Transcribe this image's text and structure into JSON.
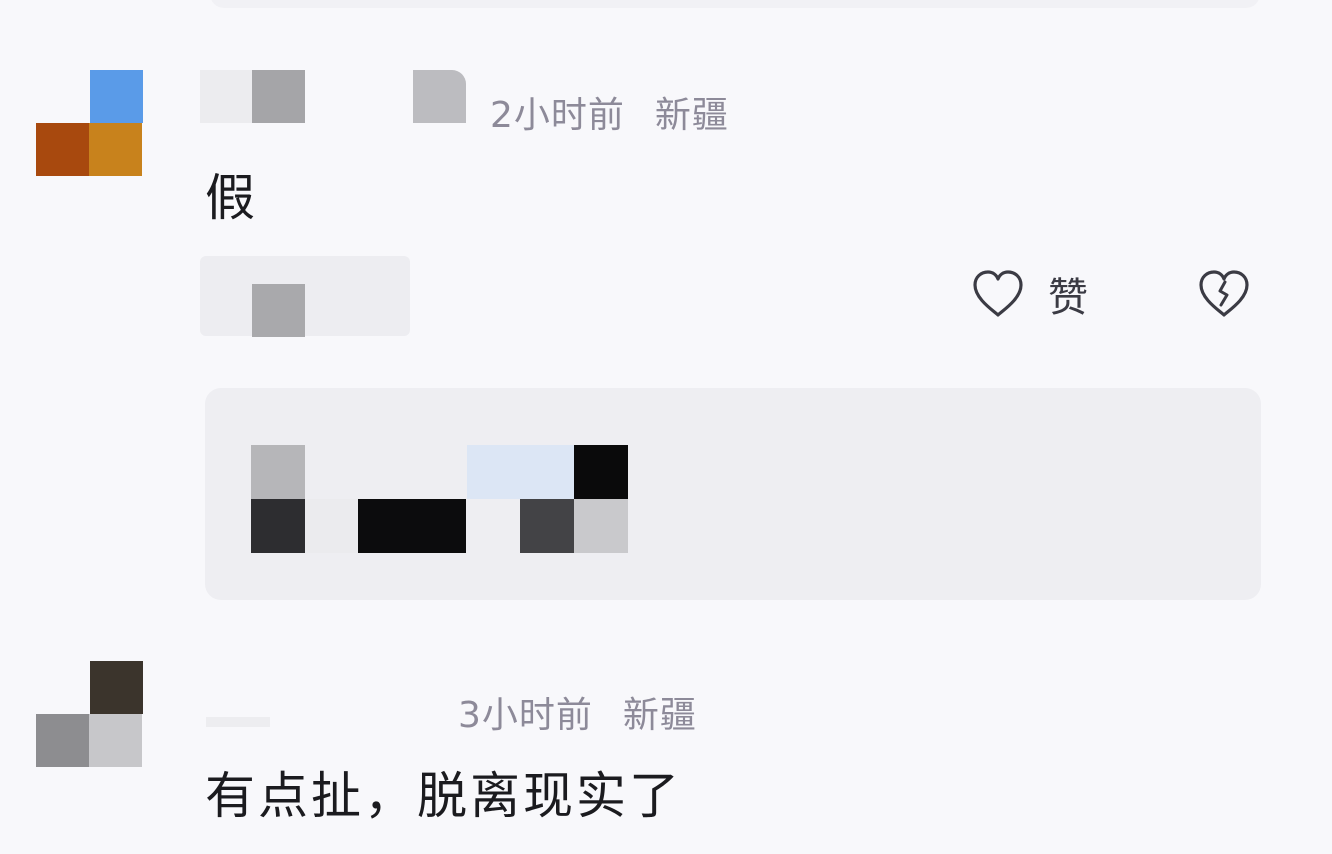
{
  "comments": [
    {
      "time": "2小时前",
      "location": "新疆",
      "text": "假",
      "actions": {
        "like_label": "赞"
      }
    },
    {
      "time": "3小时前",
      "location": "新疆",
      "text": "有点扯，脱离现实了"
    }
  ],
  "colors": {
    "meta": "#8d8a99",
    "text": "#1b1b1f",
    "reply_bg": "#eeeef2",
    "background": "#f8f8fb"
  },
  "icons": [
    "heart-outline-icon",
    "broken-heart-icon"
  ]
}
